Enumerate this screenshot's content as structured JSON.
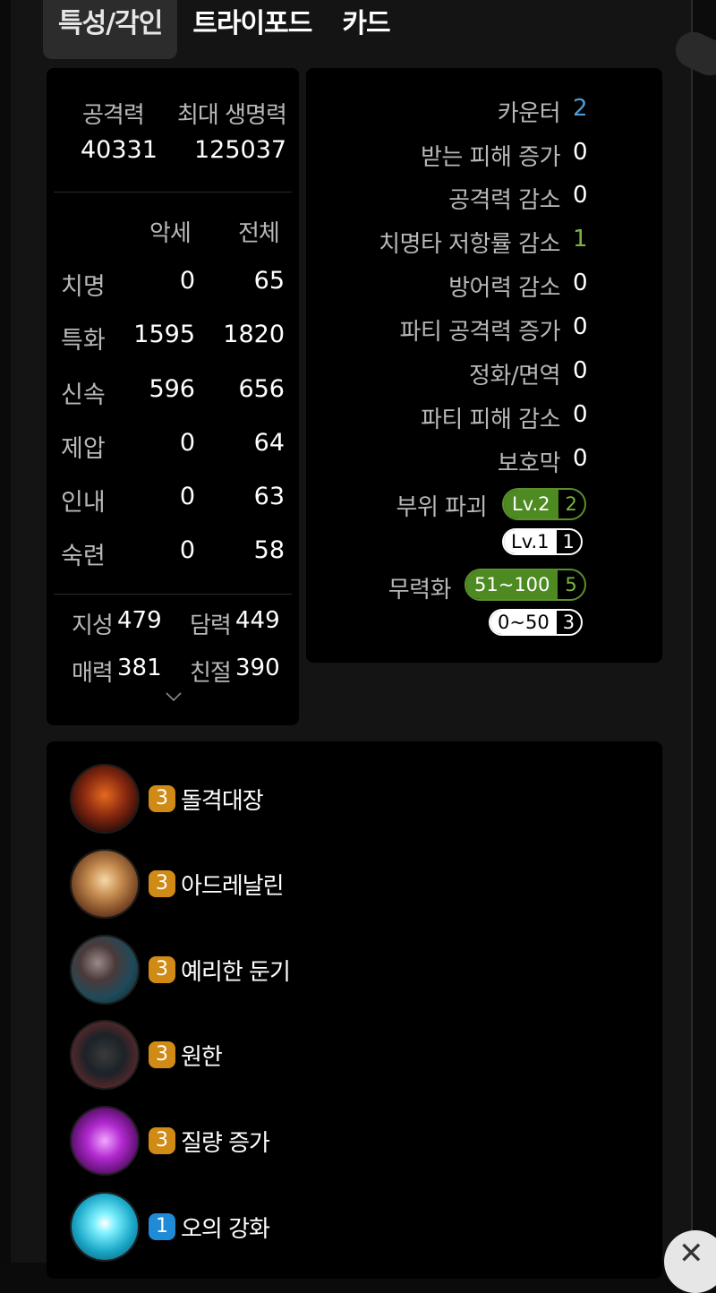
{
  "tabs": [
    {
      "label": "특성/각인"
    },
    {
      "label": "트라이포드"
    },
    {
      "label": "카드"
    }
  ],
  "stats": {
    "attack_label": "공격력",
    "attack_value": "40331",
    "hp_label": "최대 생명력",
    "hp_value": "125037",
    "col_accessory": "악세",
    "col_total": "전체",
    "rows": [
      {
        "name": "치명",
        "accessory": "0",
        "total": "65"
      },
      {
        "name": "특화",
        "accessory": "1595",
        "total": "1820"
      },
      {
        "name": "신속",
        "accessory": "596",
        "total": "656"
      },
      {
        "name": "제압",
        "accessory": "0",
        "total": "64"
      },
      {
        "name": "인내",
        "accessory": "0",
        "total": "63"
      },
      {
        "name": "숙련",
        "accessory": "0",
        "total": "58"
      }
    ],
    "tendencies": [
      {
        "name": "지성",
        "value": "479"
      },
      {
        "name": "담력",
        "value": "449"
      },
      {
        "name": "매력",
        "value": "381"
      },
      {
        "name": "친절",
        "value": "390"
      }
    ]
  },
  "effects": {
    "rows": [
      {
        "label": "카운터",
        "value": "2",
        "color": "#4a9fd8"
      },
      {
        "label": "받는 피해 증가",
        "value": "0",
        "color": "#ffffff"
      },
      {
        "label": "공격력 감소",
        "value": "0",
        "color": "#ffffff"
      },
      {
        "label": "치명타 저항률 감소",
        "value": "1",
        "color": "#7cb442"
      },
      {
        "label": "방어력 감소",
        "value": "0",
        "color": "#ffffff"
      },
      {
        "label": "파티 공격력 증가",
        "value": "0",
        "color": "#ffffff"
      },
      {
        "label": "정화/면역",
        "value": "0",
        "color": "#ffffff"
      },
      {
        "label": "파티 피해 감소",
        "value": "0",
        "color": "#ffffff"
      },
      {
        "label": "보호막",
        "value": "0",
        "color": "#ffffff"
      }
    ],
    "break": {
      "label": "부위 파괴",
      "pill1_left": "Lv.2",
      "pill1_right": "2",
      "pill2_left": "Lv.1",
      "pill2_right": "1"
    },
    "stagger": {
      "label": "무력화",
      "pill1_left": "51~100",
      "pill1_right": "5",
      "pill2_left": "0~50",
      "pill2_right": "3"
    }
  },
  "engravings": [
    {
      "level": "3",
      "name": "돌격대장",
      "icon": "charge-leader-icon"
    },
    {
      "level": "3",
      "name": "아드레날린",
      "icon": "adrenaline-icon"
    },
    {
      "level": "3",
      "name": "예리한 둔기",
      "icon": "keen-blunt-weapon-icon"
    },
    {
      "level": "3",
      "name": "원한",
      "icon": "grudge-icon"
    },
    {
      "level": "3",
      "name": "질량 증가",
      "icon": "mass-increase-icon"
    },
    {
      "level": "1",
      "name": "오의 강화",
      "icon": "esoteric-skill-enhancement-icon"
    }
  ],
  "colors": {
    "green_accent": "#4e8a22",
    "level_orange": "#d08a16",
    "level_blue": "#1f8ad6",
    "counter_blue": "#4a9fd8"
  }
}
